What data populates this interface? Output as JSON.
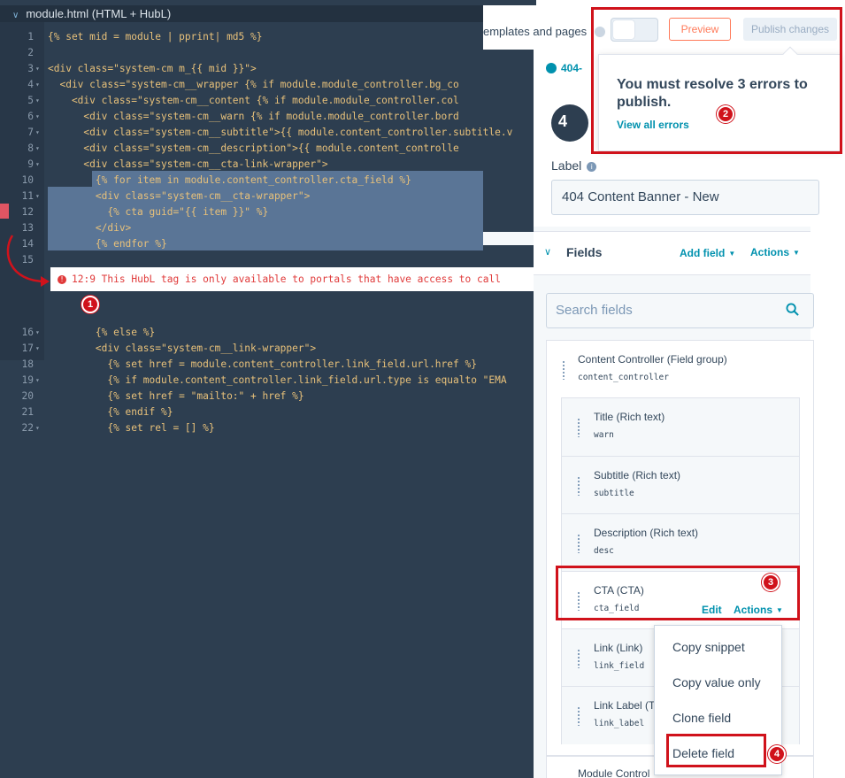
{
  "editor": {
    "title": "module.html (HTML + HubL)",
    "lines": [
      {
        "n": "1",
        "code": "{% set mid = module | pprint| md5 %}"
      },
      {
        "n": "2",
        "code": ""
      },
      {
        "n": "3",
        "code": "<div class=\"system-cm m_{{ mid }}\">"
      },
      {
        "n": "4",
        "code": "  <div class=\"system-cm__wrapper {% if module.module_controller.bg_co"
      },
      {
        "n": "5",
        "code": "    <div class=\"system-cm__content {% if module.module_controller.col"
      },
      {
        "n": "6",
        "code": "      <div class=\"system-cm__warn {% if module.module_controller.bord"
      },
      {
        "n": "7",
        "code": "      <div class=\"system-cm__subtitle\">{{ module.content_controller.subtitle.v"
      },
      {
        "n": "8",
        "code": "      <div class=\"system-cm__description\">{{ module.content_controlle"
      },
      {
        "n": "9",
        "code": "      <div class=\"system-cm__cta-link-wrapper\">"
      },
      {
        "n": "10",
        "code": "        {% for item in module.content_controller.cta_field %}"
      },
      {
        "n": "11",
        "code": "        <div class=\"system-cm__cta-wrapper\">"
      },
      {
        "n": "12",
        "code": "          {% cta guid=\"{{ item }}\" %}"
      },
      {
        "n": "13",
        "code": "        </div>"
      },
      {
        "n": "14",
        "code": "        {% endfor %}"
      },
      {
        "n": "15",
        "code": ""
      },
      {
        "n": "16",
        "code": "        {% else %}"
      },
      {
        "n": "17",
        "code": "        <div class=\"system-cm__link-wrapper\">"
      },
      {
        "n": "18",
        "code": "          {% set href = module.content_controller.link_field.url.href %}"
      },
      {
        "n": "19",
        "code": "          {% if module.content_controller.link_field.url.type is equalto \"EMA"
      },
      {
        "n": "20",
        "code": "          {% set href = \"mailto:\" + href %}"
      },
      {
        "n": "21",
        "code": "          {% endif %}"
      },
      {
        "n": "22",
        "code": "          {% set rel = [] %}"
      }
    ],
    "error_message": "12:9 This HubL tag is only available to portals that have access to call"
  },
  "topbar": {
    "label": "emplates and pages",
    "preview_label": "Preview",
    "publish_label": "Publish changes"
  },
  "popover": {
    "title": "You must resolve 3 errors to publish.",
    "link": "View all errors"
  },
  "panel": {
    "tab_label": "404-",
    "logo_text": "4",
    "label_title": "Label",
    "label_value": "404 Content Banner - New",
    "fields_title": "Fields",
    "add_field": "Add field",
    "actions": "Actions",
    "search_placeholder": "Search fields",
    "group": {
      "name": "Content Controller (Field group)",
      "key": "content_controller"
    },
    "fields": [
      {
        "name": "Title (Rich text)",
        "key": "warn"
      },
      {
        "name": "Subtitle (Rich text)",
        "key": "subtitle"
      },
      {
        "name": "Description (Rich text)",
        "key": "desc"
      },
      {
        "name": "CTA (CTA)",
        "key": "cta_field",
        "edit": "Edit",
        "actions": "Actions"
      },
      {
        "name": "Link (Link)",
        "key": "link_field"
      },
      {
        "name": "Link Label (T",
        "key": "link_label"
      }
    ],
    "group2_name": "Module Control"
  },
  "dropdown": {
    "items": [
      "Copy snippet",
      "Copy value only",
      "Clone field",
      "Delete field"
    ]
  },
  "badges": [
    "1",
    "2",
    "3",
    "4"
  ],
  "colors": {
    "highlight": "#d0121b",
    "link": "#0091ae",
    "accent": "#ff7a59",
    "editor_bg": "#2d3e50"
  }
}
